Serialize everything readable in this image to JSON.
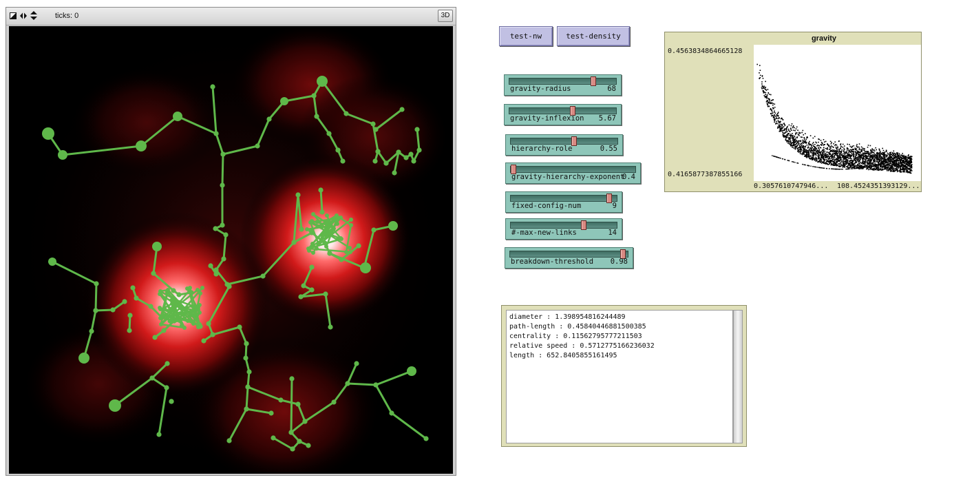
{
  "view": {
    "ticks_label": "ticks: 0",
    "three_d_label": "3D"
  },
  "buttons": [
    {
      "label": "test-nw"
    },
    {
      "label": "test-density"
    }
  ],
  "sliders": [
    {
      "label": "gravity-radius",
      "value": "68",
      "position": 0.8
    },
    {
      "label": "gravity-inflexion",
      "value": "5.67",
      "position": 0.6
    },
    {
      "label": "hierarchy-role",
      "value": "0.55",
      "position": 0.6
    },
    {
      "label": "gravity-hierarchy-exponent",
      "value": "0.4",
      "position": 0.0
    },
    {
      "label": "fixed-config-num",
      "value": "9",
      "position": 0.95
    },
    {
      "label": "#-max-new-links",
      "value": "14",
      "position": 0.7
    },
    {
      "label": "breakdown-threshold",
      "value": "0.98",
      "position": 0.98
    }
  ],
  "plot": {
    "title": "gravity",
    "y_max": "0.4563834864665128",
    "y_min": "0.4165877387855166",
    "x_min": "0.3057610747946...",
    "x_max": "108.4524351393129..."
  },
  "output": {
    "lines": [
      "diameter : 1.398954816244489",
      "path-length : 0.45840446881500385",
      "centrality : 0.11562795777211503",
      "relative speed : 0.5712775166236032",
      "length : 652.8405855161495"
    ]
  },
  "colors": {
    "network": "#5fb84a",
    "density_peak": "#ffffff",
    "density_mid": "#d81818",
    "background": "#000000",
    "button": "#c1c0e3",
    "slider": "#8ec6b9",
    "monitor": "#e0e0b9"
  },
  "icons": [
    "view-size-icon",
    "horizontal-arrows-icon",
    "vertical-arrows-icon"
  ]
}
